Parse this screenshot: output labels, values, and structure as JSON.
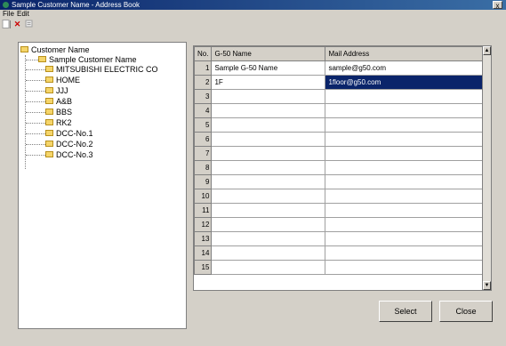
{
  "window": {
    "title": "Sample Customer Name - Address Book",
    "close_glyph": "x"
  },
  "menu": {
    "file": "File",
    "edit": "Edit"
  },
  "toolbar": {
    "new_icon": "document-icon",
    "delete_icon": "delete-x-icon",
    "delete_glyph": "✕",
    "delete_color": "#cc0000",
    "props_icon": "properties-icon"
  },
  "tree": {
    "root": "Customer Name",
    "items": [
      "Sample Customer Name",
      "MITSUBISHI ELECTRIC CO",
      "HOME",
      "JJJ",
      "A&B",
      "BBS",
      "RK2",
      "DCC-No.1",
      "DCC-No.2",
      "DCC-No.3"
    ]
  },
  "grid": {
    "headers": {
      "no": "No.",
      "name": "G-50 Name",
      "mail": "Mail Address"
    },
    "rows": [
      {
        "no": "1",
        "name": "Sample G-50 Name",
        "mail": "sample@g50.com"
      },
      {
        "no": "2",
        "name": "1F",
        "mail": "1floor@g50.com"
      },
      {
        "no": "3",
        "name": "",
        "mail": ""
      },
      {
        "no": "4",
        "name": "",
        "mail": ""
      },
      {
        "no": "5",
        "name": "",
        "mail": ""
      },
      {
        "no": "6",
        "name": "",
        "mail": ""
      },
      {
        "no": "7",
        "name": "",
        "mail": ""
      },
      {
        "no": "8",
        "name": "",
        "mail": ""
      },
      {
        "no": "9",
        "name": "",
        "mail": ""
      },
      {
        "no": "10",
        "name": "",
        "mail": ""
      },
      {
        "no": "11",
        "name": "",
        "mail": ""
      },
      {
        "no": "12",
        "name": "",
        "mail": ""
      },
      {
        "no": "13",
        "name": "",
        "mail": ""
      },
      {
        "no": "14",
        "name": "",
        "mail": ""
      },
      {
        "no": "15",
        "name": "",
        "mail": ""
      }
    ],
    "selected_row": 2,
    "selection_color": "#0a246a"
  },
  "buttons": {
    "select": "Select",
    "close": "Close"
  }
}
